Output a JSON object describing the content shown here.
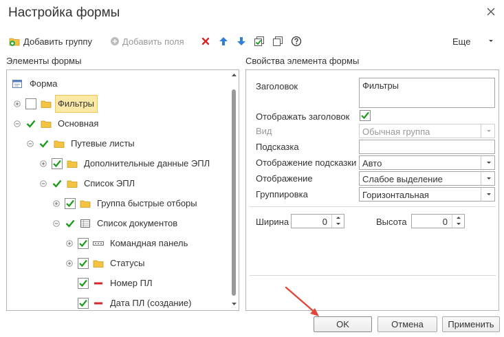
{
  "window": {
    "title": "Настройка формы"
  },
  "toolbar": {
    "add_group": "Добавить группу",
    "add_fields": "Добавить поля",
    "more": "Еще"
  },
  "left_panel": {
    "label": "Элементы формы"
  },
  "right_panel": {
    "label": "Свойства элемента формы"
  },
  "tree": [
    {
      "label": "Форма",
      "expander": "none",
      "checked": null,
      "icon": "form-icon",
      "selected": false
    },
    {
      "label": "Фильтры",
      "expander": "plus",
      "checked": false,
      "icon": "folder-icon",
      "selected": true
    },
    {
      "label": "Основная",
      "expander": "minus",
      "checked": true,
      "icon": "folder-icon",
      "selected": false
    },
    {
      "label": "Путевые листы",
      "expander": "minus",
      "checked": true,
      "icon": "folder-icon",
      "selected": false
    },
    {
      "label": "Дополнительные данные ЭПЛ",
      "expander": "plus",
      "checked": true,
      "icon": "folder-icon",
      "selected": false
    },
    {
      "label": "Список ЭПЛ",
      "expander": "minus",
      "checked": true,
      "icon": "folder-icon",
      "selected": false
    },
    {
      "label": "Группа быстрые отборы",
      "expander": "plus",
      "checked": true,
      "icon": "folder-icon",
      "selected": false
    },
    {
      "label": "Список документов",
      "expander": "minus",
      "checked": true,
      "icon": "table-icon",
      "selected": false
    },
    {
      "label": "Командная панель",
      "expander": "plus",
      "checked": true,
      "icon": "command-bar-icon",
      "selected": false
    },
    {
      "label": "Статусы",
      "expander": "plus",
      "checked": true,
      "icon": "folder-icon",
      "selected": false
    },
    {
      "label": "Номер ПЛ",
      "expander": "none",
      "checked": true,
      "icon": "field-icon",
      "selected": false
    },
    {
      "label": "Дата ПЛ (создание)",
      "expander": "none",
      "checked": true,
      "icon": "field-icon",
      "selected": false
    }
  ],
  "properties": {
    "title_label": "Заголовок",
    "title_value": "Фильтры",
    "show_title_label": "Отображать заголовок",
    "show_title_checked": true,
    "kind_label": "Вид",
    "kind_value": "Обычная группа",
    "hint_label": "Подсказка",
    "hint_value": "",
    "hint_display_label": "Отображение подсказки",
    "hint_display_value": "Авто",
    "display_label": "Отображение",
    "display_value": "Слабое выделение",
    "grouping_label": "Группировка",
    "grouping_value": "Горизонтальная",
    "width_label": "Ширина",
    "width_value": "0",
    "height_label": "Высота",
    "height_value": "0"
  },
  "buttons": {
    "ok": "OK",
    "cancel": "Отмена",
    "apply": "Применить"
  },
  "colors": {
    "check_green": "#1a9c1a",
    "folder_yellow": "#f5c342",
    "delete_red": "#d7262b",
    "arrow_blue": "#2f7fd6",
    "selection_bg": "#fde9a6",
    "annotation_arrow": "#e0463a"
  }
}
